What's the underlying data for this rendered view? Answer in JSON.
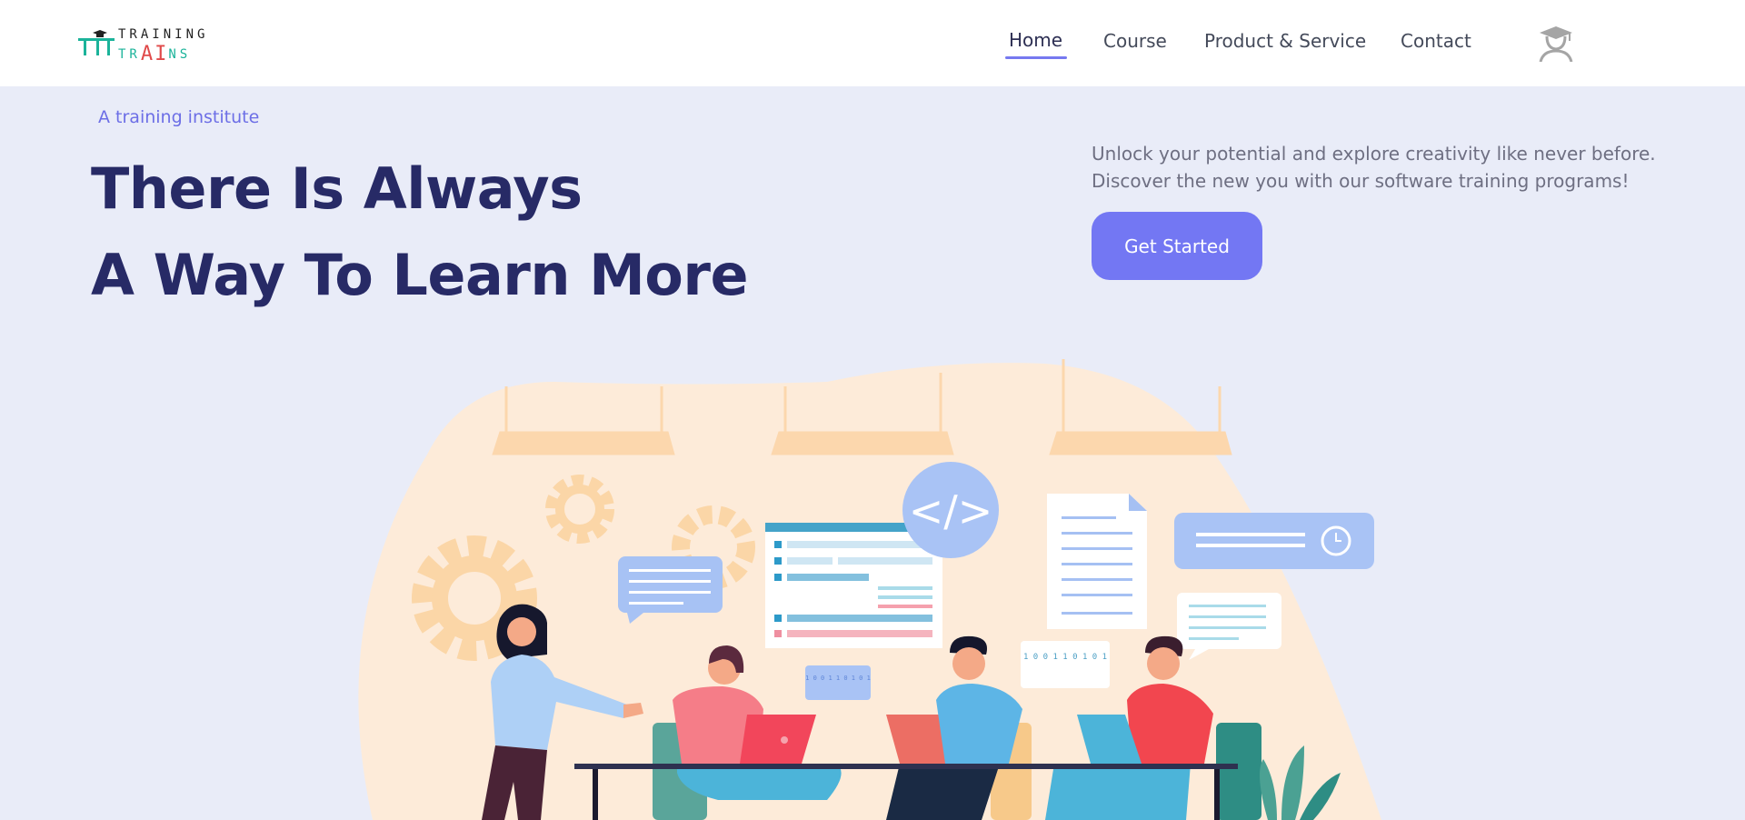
{
  "brand": {
    "line1": "TRAINING",
    "line2_prefix": "TR",
    "line2_ai": "AI",
    "line2_suffix": "NS",
    "colors": {
      "teal": "#1bb39a",
      "red": "#e04a4a",
      "dark": "#222222"
    }
  },
  "nav": {
    "items": [
      {
        "label": "Home",
        "active": true
      },
      {
        "label": "Course",
        "active": false
      },
      {
        "label": "Product & Service",
        "active": false
      },
      {
        "label": "Contact",
        "active": false
      }
    ],
    "avatar_icon": "graduate-avatar-icon",
    "accent": "#7679f0"
  },
  "hero": {
    "tagline": "A training institute",
    "title_line1": "There Is Always",
    "title_line2": "A Way To Learn More",
    "description": "Unlock your potential and explore creativity like never before. Discover the new you with our software training programs!",
    "cta_label": "Get Started",
    "colors": {
      "title": "#272a66",
      "tagline": "#6c6ee6",
      "cta": "#7377f3",
      "background": "#e9ecf8"
    }
  },
  "illustration": {
    "code_symbol": "</>",
    "binary_left": "1 0 0 1 1 0 1 0 1",
    "binary_right": "1 0 0 1 1 0 1 0 1"
  }
}
